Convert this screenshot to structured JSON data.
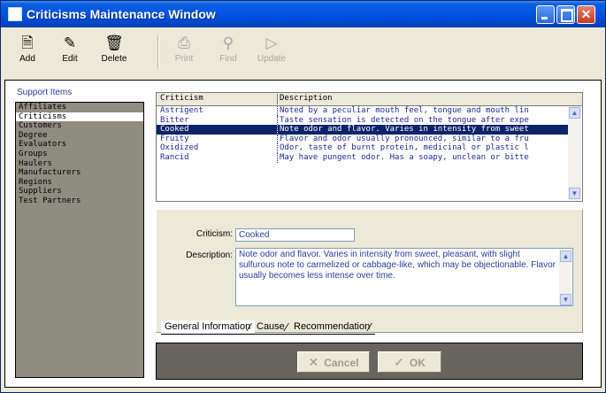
{
  "window": {
    "title": "Criticisms Maintenance Window"
  },
  "toolbar": {
    "add": "Add",
    "edit": "Edit",
    "delete": "Delete",
    "print": "Print",
    "find": "Find",
    "update": "Update"
  },
  "support": {
    "label": "Support Items",
    "items": [
      "Affiliates",
      "Criticisms",
      "Customers",
      "Degree",
      "Evaluators",
      "Groups",
      "Haulers",
      "Manufacturers",
      "Regions",
      "Suppliers",
      "Test Partners"
    ],
    "selected": "Criticisms"
  },
  "grid": {
    "columns": [
      "Criticism",
      "Description"
    ],
    "rows": [
      {
        "criticism": "Astrigent",
        "description": "Noted by a peculiar mouth feel, tongue and mouth lin"
      },
      {
        "criticism": "Bitter",
        "description": "Taste sensation is detected on the tongue after expe"
      },
      {
        "criticism": "Cooked",
        "description": "Note odor and flavor. Varies in intensity from sweet"
      },
      {
        "criticism": "Fruity",
        "description": "Flavor and odor usually pronounced, similar to a fru"
      },
      {
        "criticism": "Oxidized",
        "description": "Odor, taste of burnt protein, medicinal or plastic l"
      },
      {
        "criticism": "Rancid",
        "description": "May have pungent odor. Has a soapy, unclean or bitte"
      }
    ],
    "selected": "Cooked"
  },
  "detail": {
    "criticism_label": "Criticism:",
    "criticism_value": "Cooked",
    "description_label": "Description:",
    "description_value": "Note odor and flavor. Varies in intensity from sweet, pleasant, with slight sulfurous note to carmelized or cabbage-like, which may be objectionable. Flavor usually becomes less intense over time."
  },
  "tabs": [
    "General Information",
    "Cause",
    "Recommendation"
  ],
  "buttons": {
    "cancel": "Cancel",
    "ok": "OK"
  },
  "icons": {
    "add": "add-icon",
    "edit": "edit-icon",
    "delete": "trash-icon",
    "print": "printer-icon",
    "find": "find-icon",
    "update": "update-icon",
    "cancel": "x-icon",
    "ok": "check-icon"
  },
  "colors": {
    "titlebar": "#0054e3",
    "selection": "#0a246a",
    "text_blue": "#1e2a9a"
  }
}
